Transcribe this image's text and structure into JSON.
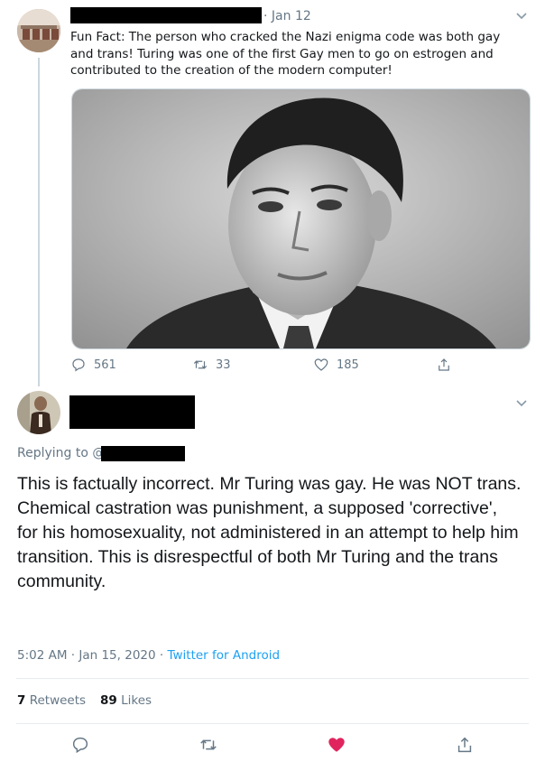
{
  "tweet1": {
    "date": "Jan 12",
    "text": "Fun Fact: The person who cracked the Nazi enigma code was both gay and trans! Turing was one of the first Gay men to go on estrogen and contributed to the creation of the modern computer!",
    "actions": {
      "replies": "561",
      "retweets": "33",
      "likes": "185"
    }
  },
  "tweet2": {
    "replying_prefix": "Replying to @",
    "body": "This is factually incorrect. Mr Turing was gay. He was NOT trans. Chemical castration was punishment, a supposed 'corrective', for his homosexuality, not administered in an attempt to help him transition. This is disrespectful of both Mr Turing and the trans community.",
    "timestamp": "5:02 AM · Jan 15, 2020 · ",
    "source": "Twitter for Android",
    "stats": {
      "retweets_count": "7",
      "retweets_label": "Retweets",
      "likes_count": "89",
      "likes_label": "Likes"
    }
  },
  "colors": {
    "accent": "#1da1f2",
    "like": "#e0245e",
    "muted": "#657786"
  },
  "icons": [
    "reply-icon",
    "retweet-icon",
    "like-icon",
    "share-icon",
    "chevron-down-icon",
    "heart-filled-icon"
  ]
}
